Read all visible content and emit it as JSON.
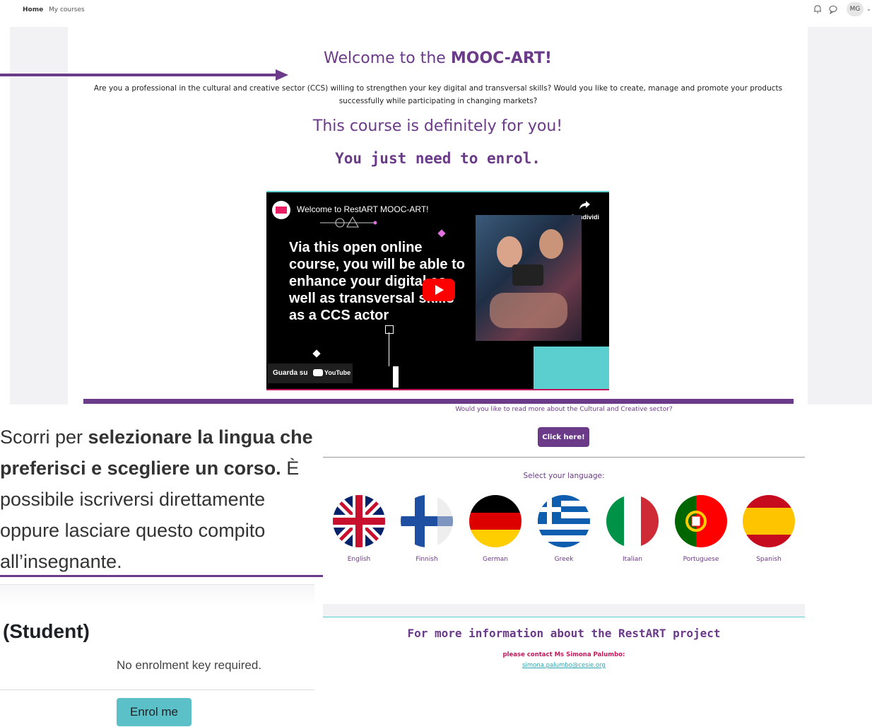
{
  "nav": {
    "home": "Home",
    "my_courses": "My courses",
    "avatar_initials": "MG",
    "avatar_caret": "⌄"
  },
  "hero": {
    "title_prefix": "Welcome to the ",
    "title_bold": "MOOC-ART!",
    "intro": "Are you a professional in the cultural and creative sector (CCS) willing to strengthen your key digital and transversal skills? Would you like to create, manage and promote your products successfully while participating in changing markets?",
    "for_you": "This course is definitely for you!",
    "enrol": "You just need to enrol."
  },
  "video": {
    "title": "Welcome to RestART MOOC-ART!",
    "share_label": "Condividi",
    "text": "Via this open online course, you will be able to enhance your digital as well as transversal skills as a CCS actor",
    "watch_on": "Guarda su",
    "youtube": "YouTube"
  },
  "overlay": {
    "part1": "Scorri per ",
    "bold1": "selezionare la lingua che preferisci e scegliere un corso.",
    "part2": " È possibile iscriversi direttamente oppure lasciare questo compito all’insegnante."
  },
  "enrolment": {
    "title": "(Student)",
    "no_key": "No enrolment key required.",
    "button": "Enrol me"
  },
  "lang_section": {
    "read_more": "Would you like to read more about the Cultural and Creative sector?",
    "click_here": "Click here!",
    "select_language": "Select your language:",
    "languages": [
      "English",
      "Finnish",
      "German",
      "Greek",
      "Italian",
      "Portuguese",
      "Spanish"
    ]
  },
  "info": {
    "title": "For more information about the RestART project",
    "contact": "please contact Ms Simona Palumbo:",
    "email": "simona.palumbo@cesie.org"
  },
  "colors": {
    "brand_purple": "#6b3a88",
    "accent_teal": "#5bcfd0",
    "accent_pink": "#c2185b"
  }
}
